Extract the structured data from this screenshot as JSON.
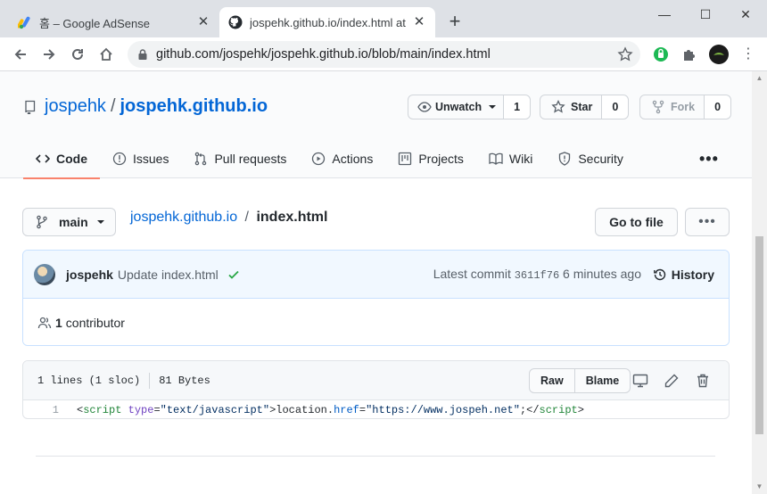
{
  "browser": {
    "tabs": [
      {
        "title": "홈 – Google AdSense",
        "active": false
      },
      {
        "title": "jospehk.github.io/index.html at",
        "active": true
      }
    ],
    "url": "github.com/jospehk/jospehk.github.io/blob/main/index.html"
  },
  "repo": {
    "owner": "jospehk",
    "separator": "/",
    "name": "jospehk.github.io",
    "unwatch": {
      "label": "Unwatch",
      "count": "1"
    },
    "star": {
      "label": "Star",
      "count": "0"
    },
    "fork": {
      "label": "Fork",
      "count": "0"
    }
  },
  "nav": {
    "tabs": [
      {
        "label": "Code",
        "icon": "code-icon"
      },
      {
        "label": "Issues",
        "icon": "issue-icon"
      },
      {
        "label": "Pull requests",
        "icon": "pull-request-icon"
      },
      {
        "label": "Actions",
        "icon": "play-icon"
      },
      {
        "label": "Projects",
        "icon": "project-icon"
      },
      {
        "label": "Wiki",
        "icon": "book-icon"
      },
      {
        "label": "Security",
        "icon": "shield-icon"
      }
    ],
    "more": "•••"
  },
  "file_nav": {
    "branch": "main",
    "repo_link": "jospehk.github.io",
    "separator": "/",
    "file": "index.html",
    "go_to_file": "Go to file",
    "more": "•••"
  },
  "commit": {
    "author": "jospehk",
    "message": "Update index.html",
    "latest_prefix": "Latest commit",
    "sha": "3611f76",
    "time": "6 minutes ago",
    "history": "History"
  },
  "contributors": {
    "count": "1",
    "label": "contributor"
  },
  "file": {
    "lines": "1 lines (1 sloc)",
    "size": "81 Bytes",
    "raw": "Raw",
    "blame": "Blame",
    "code_lines": [
      {
        "number": "1",
        "tokens": {
          "open": "<",
          "tag": "script",
          "sp": " ",
          "attr": "type",
          "eq": "=",
          "attr_val": "\"text/javascript\"",
          "gt": ">",
          "obj": "location.",
          "prop": "href",
          "eq2": "=",
          "str": "\"https://www.jospeh.net\"",
          "semi": ";",
          "close_open": "</",
          "close_tag": "script",
          "close_gt": ">"
        }
      }
    ]
  },
  "colors": {
    "link": "#0366d6",
    "active_tab_underline": "#f9826c",
    "commit_bg": "#f1f8ff",
    "check_green": "#28a745"
  }
}
